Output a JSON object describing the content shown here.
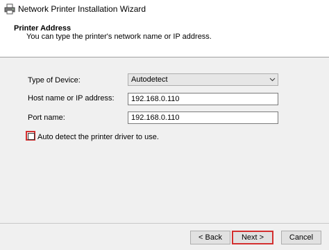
{
  "window": {
    "title": "Network Printer Installation Wizard"
  },
  "header": {
    "title": "Printer Address",
    "subtitle": "You can type the printer's network name or IP address."
  },
  "form": {
    "device_type_label": "Type of Device:",
    "device_type_value": "Autodetect",
    "host_label": "Host name or IP address:",
    "host_value": "192.168.0.110",
    "port_label": "Port name:",
    "port_value": "192.168.0.110",
    "auto_detect_label": "Auto detect the printer driver to use.",
    "auto_detect_checked": false
  },
  "buttons": {
    "back": "< Back",
    "next": "Next >",
    "cancel": "Cancel"
  },
  "colors": {
    "highlight": "#d32f2f"
  },
  "icons": {
    "title": "printer-icon",
    "dropdown": "chevron-down-icon"
  }
}
